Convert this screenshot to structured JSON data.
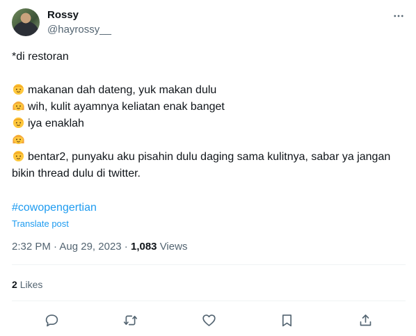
{
  "author": {
    "display_name": "Rossy",
    "handle": "@hayrossy__"
  },
  "tweet": {
    "lines": [
      {
        "emoji": "",
        "text": "*di restoran"
      },
      {
        "emoji": "",
        "text": ""
      },
      {
        "emoji": "boy-face",
        "text": "makanan dah dateng, yuk makan dulu"
      },
      {
        "emoji": "girl-face",
        "text": "wih, kulit ayamnya keliatan enak banget"
      },
      {
        "emoji": "boy-face",
        "text": "iya enaklah"
      },
      {
        "emoji": "girl-face",
        "text": ""
      },
      {
        "emoji": "boy-face",
        "text": "bentar2, punyaku aku pisahin dulu daging sama kulitnya, sabar ya jangan bikin thread dulu di twitter."
      }
    ],
    "hashtag": "#cowopengertian",
    "translate_label": "Translate post",
    "time": "2:32 PM",
    "date": "Aug 29, 2023",
    "separator": " · ",
    "views_count": "1,083",
    "views_label": "Views",
    "likes_count": "2",
    "likes_label": "Likes"
  },
  "icons": {
    "more": "more-horizontal-icon",
    "reply": "reply-icon",
    "retweet": "retweet-icon",
    "like": "heart-icon",
    "bookmark": "bookmark-icon",
    "share": "share-icon"
  },
  "colors": {
    "text": "#0f1419",
    "secondary": "#536471",
    "link": "#1d9bf0",
    "divider": "#eff3f4"
  }
}
